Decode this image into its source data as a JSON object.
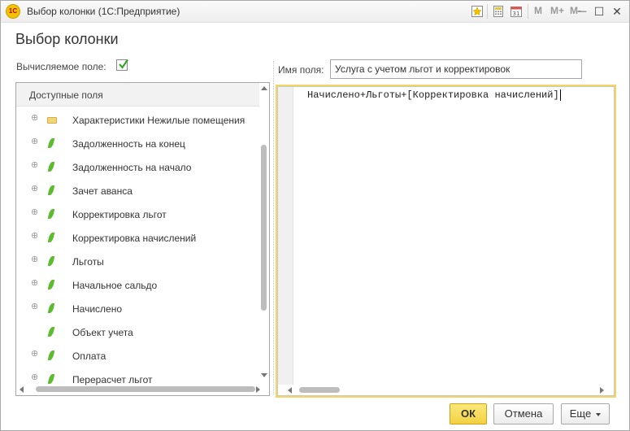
{
  "window": {
    "title": "Выбор колонки  (1С:Предприятие)",
    "app_icon_text": "1С",
    "toolbar": {
      "m_label": "M",
      "m_plus_label": "M+",
      "m_minus_label": "M-"
    },
    "controls": {
      "minimize_glyph": "—",
      "maximize_glyph": "☐",
      "close_glyph": "✕"
    }
  },
  "form": {
    "heading": "Выбор колонки",
    "calculated_field_label": "Вычисляемое поле:",
    "calculated_field_checked": true
  },
  "fields_panel": {
    "header": "Доступные поля",
    "items": [
      {
        "label": "Характеристики Нежилые помещения",
        "icon": "folder-icon",
        "expandable": true
      },
      {
        "label": "Задолженность на конец",
        "icon": "leaf-icon",
        "expandable": true
      },
      {
        "label": "Задолженность на начало",
        "icon": "leaf-icon",
        "expandable": true
      },
      {
        "label": "Зачет аванса",
        "icon": "leaf-icon",
        "expandable": true
      },
      {
        "label": "Корректировка льгот",
        "icon": "leaf-icon",
        "expandable": true
      },
      {
        "label": "Корректировка начислений",
        "icon": "leaf-icon",
        "expandable": true
      },
      {
        "label": "Льготы",
        "icon": "leaf-icon",
        "expandable": true
      },
      {
        "label": "Начальное сальдо",
        "icon": "leaf-icon",
        "expandable": true
      },
      {
        "label": "Начислено",
        "icon": "leaf-icon",
        "expandable": true
      },
      {
        "label": "Объект учета",
        "icon": "leaf-icon",
        "expandable": false
      },
      {
        "label": "Оплата",
        "icon": "leaf-icon",
        "expandable": true
      },
      {
        "label": "Перерасчет льгот",
        "icon": "leaf-icon",
        "expandable": true
      }
    ]
  },
  "field_name": {
    "label": "Имя поля:",
    "value": "Услуга с учетом льгот и корректировок"
  },
  "expression": {
    "text": "Начислено+Льготы+[Корректировка начислений]"
  },
  "buttons": {
    "ok": "ОК",
    "cancel": "Отмена",
    "more": "Еще"
  },
  "colors": {
    "ok_button": "#f3d142",
    "editor_focus_border": "#f2d563",
    "leaf_icon": "#5dbb2f",
    "check_mark": "#3aa52b"
  }
}
